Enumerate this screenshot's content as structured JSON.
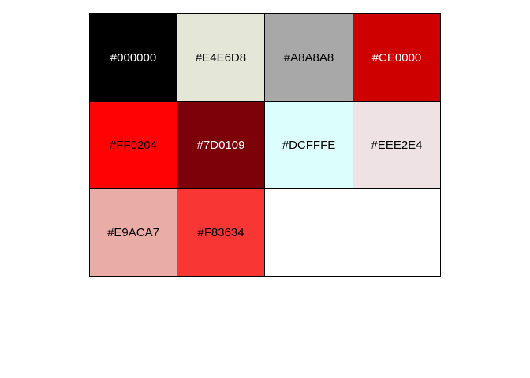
{
  "palette": {
    "columns": 4,
    "swatches": [
      {
        "label": "#000000",
        "color": "#000000",
        "text_color": "#ffffff"
      },
      {
        "label": "#E4E6D8",
        "color": "#E4E6D8",
        "text_color": "#000000"
      },
      {
        "label": "#A8A8A8",
        "color": "#A8A8A8",
        "text_color": "#000000"
      },
      {
        "label": "#CE0000",
        "color": "#CE0000",
        "text_color": "#ffffff"
      },
      {
        "label": "#FF0204",
        "color": "#FF0204",
        "text_color": "#000000"
      },
      {
        "label": "#7D0109",
        "color": "#7D0109",
        "text_color": "#ffffff"
      },
      {
        "label": "#DCFFFE",
        "color": "#DCFFFE",
        "text_color": "#000000"
      },
      {
        "label": "#EEE2E4",
        "color": "#EEE2E4",
        "text_color": "#000000"
      },
      {
        "label": "#E9ACA7",
        "color": "#E9ACA7",
        "text_color": "#000000"
      },
      {
        "label": "#F83634",
        "color": "#F83634",
        "text_color": "#000000"
      },
      {
        "label": "",
        "color": "#ffffff",
        "text_color": "#000000"
      },
      {
        "label": "",
        "color": "#ffffff",
        "text_color": "#000000"
      }
    ]
  }
}
